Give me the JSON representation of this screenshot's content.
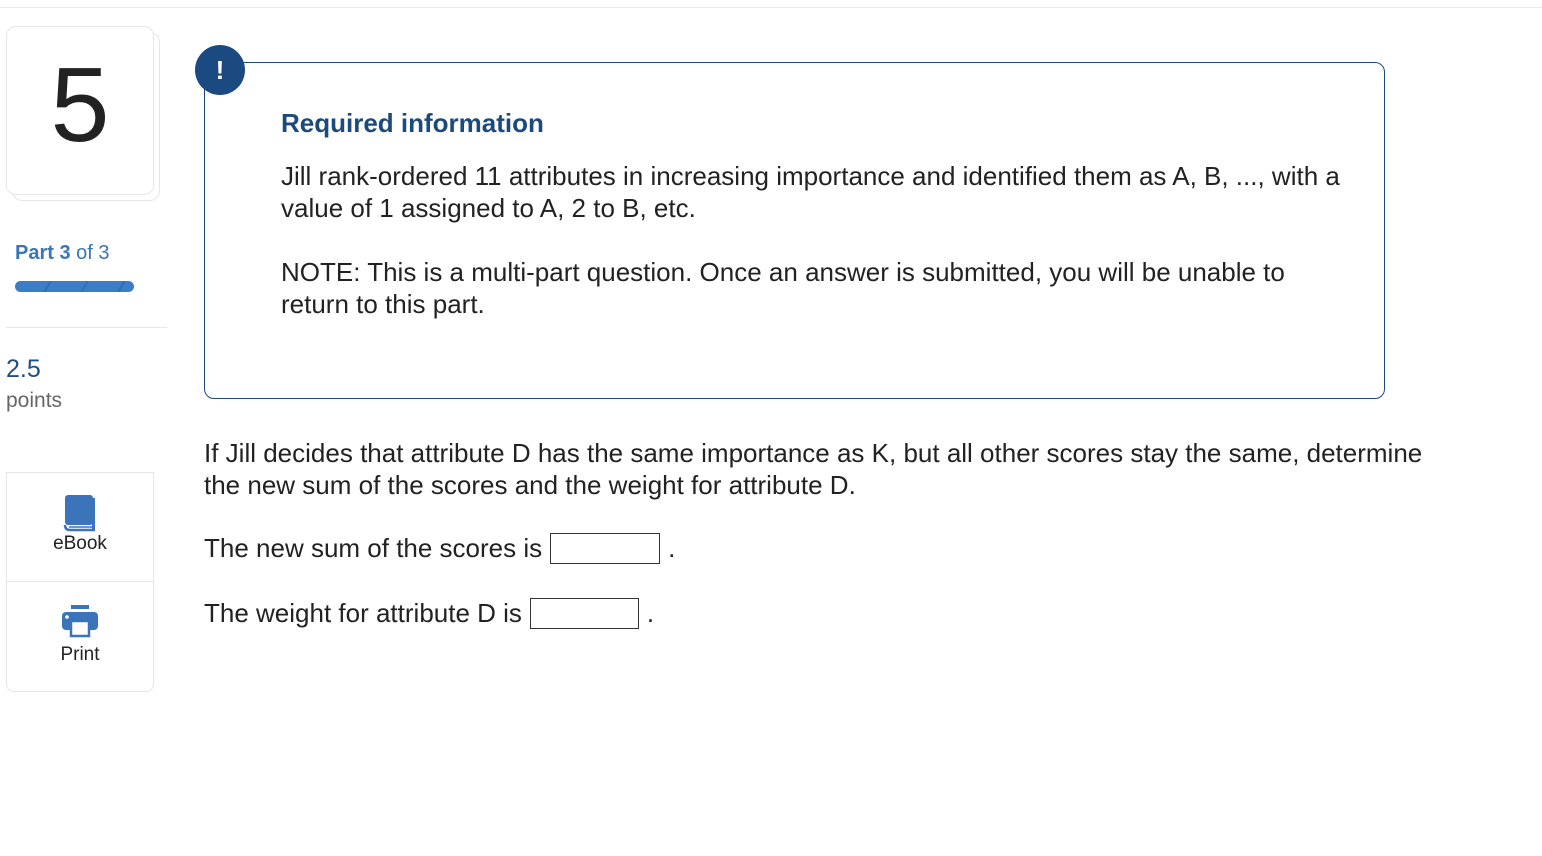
{
  "question": {
    "number": "5",
    "part_label": "Part",
    "part_current": "3",
    "part_of": "of 3",
    "progress": {
      "completed_parts": 3,
      "total_parts": 3
    },
    "points_value": "2.5",
    "points_label": "points"
  },
  "tools": [
    {
      "label": "eBook",
      "icon": "book-icon"
    },
    {
      "label": "Print",
      "icon": "printer-icon"
    }
  ],
  "required_info": {
    "icon": "!",
    "title": "Required information",
    "paragraph1": "Jill rank-ordered 11 attributes in increasing importance and identified them as A, B, ..., with a value of 1 assigned to A, 2 to B, etc.",
    "paragraph2": "NOTE: This is a multi-part question. Once an answer is submitted, you will be unable to return to this part."
  },
  "prompt": "If Jill decides that attribute D has the same importance as K, but all other scores stay the same, determine the new sum of the scores and the weight for attribute D.",
  "answers": [
    {
      "label": "The new sum of the scores is",
      "value": "",
      "suffix": "."
    },
    {
      "label": "The weight for attribute D is",
      "value": "",
      "suffix": "."
    }
  ],
  "colors": {
    "accent": "#1d4a7c",
    "link_blue": "#3a75b8",
    "progress": "#3b7dc6"
  }
}
